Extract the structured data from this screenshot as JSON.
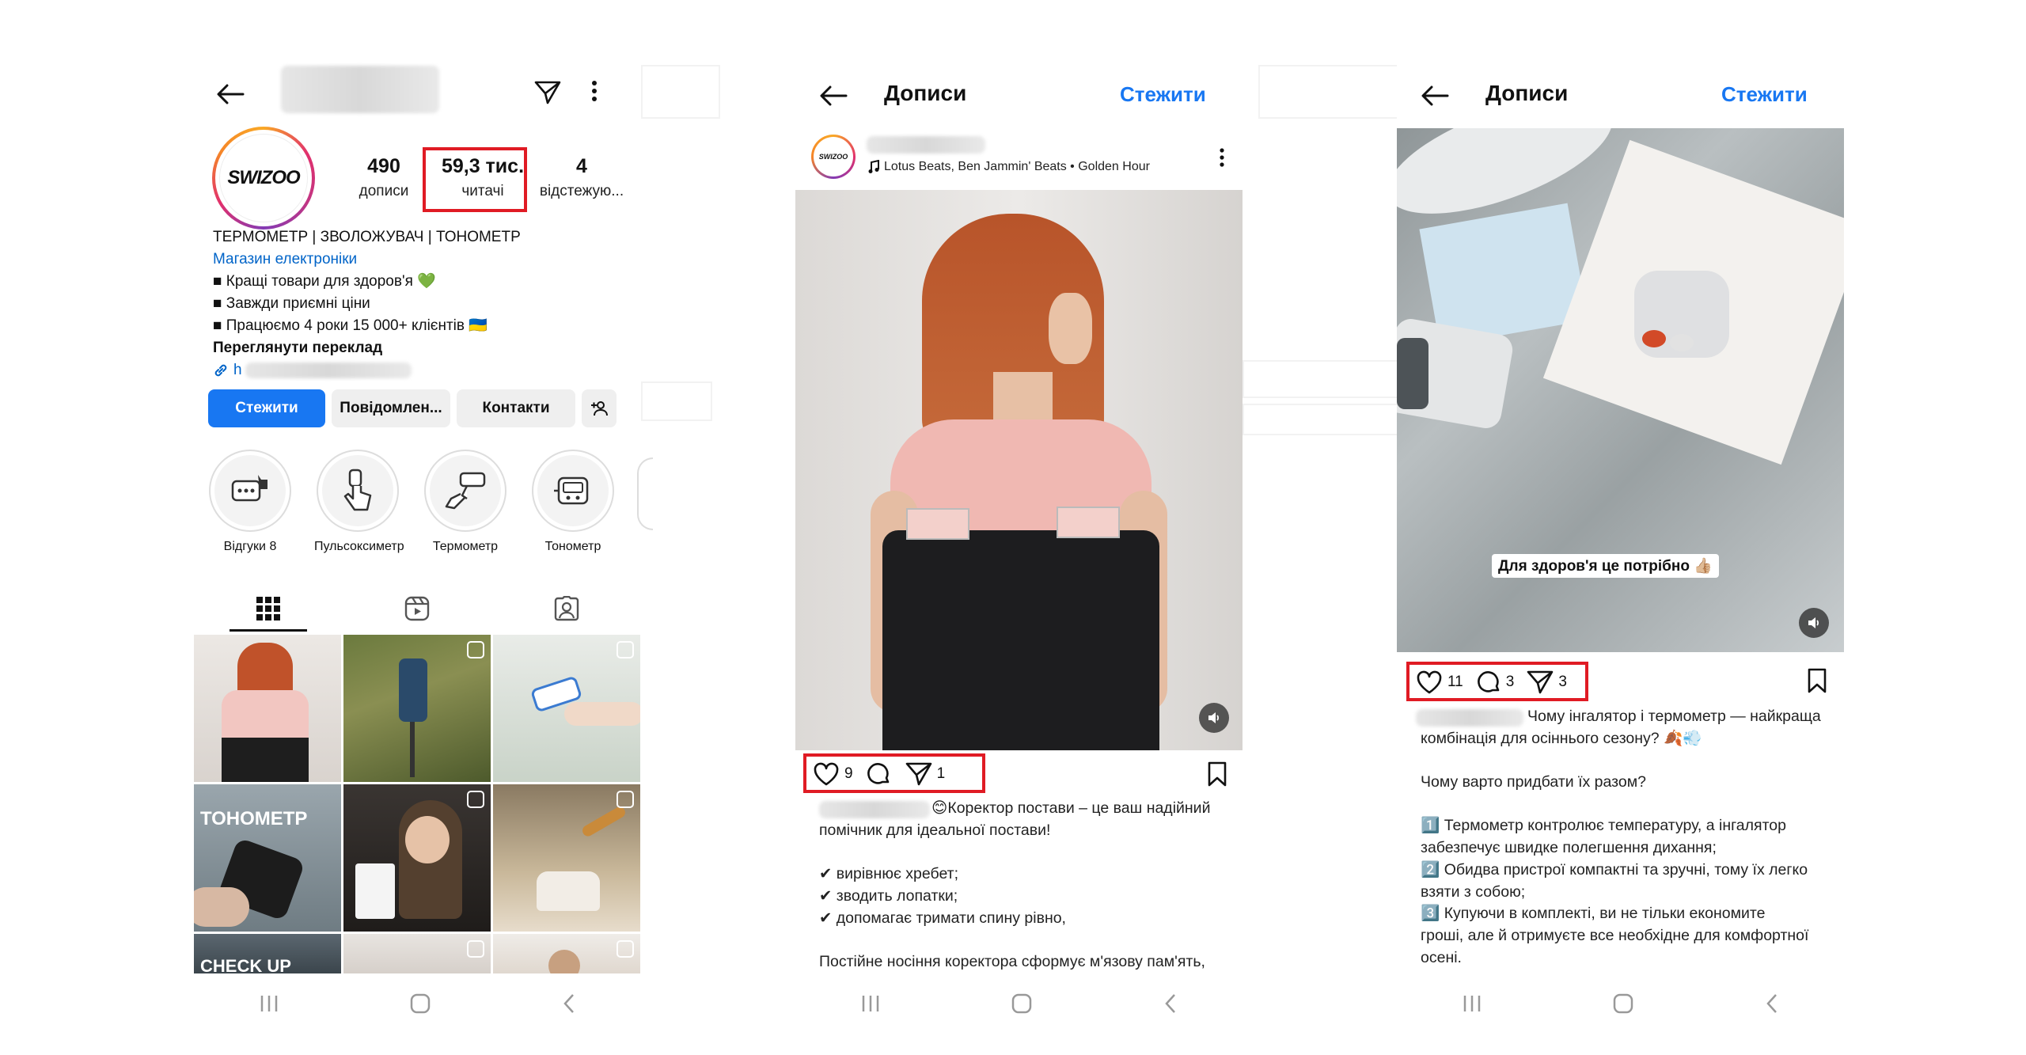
{
  "profile": {
    "stats": [
      {
        "value": "490",
        "label": "дописи"
      },
      {
        "value": "59,3 тис.",
        "label": "читачі"
      },
      {
        "value": "4",
        "label": "відстежую..."
      }
    ],
    "avatar_text": "SWIZOO",
    "bio_title": "ТЕРМОМЕТР | ЗВОЛОЖУВАЧ | ТОНОМЕТР",
    "category": "Магазин електроніки",
    "bio_lines": [
      "■ Кращі товари для здоров'я 💚",
      "■ Завжди приємні ціни",
      "■ Працюємо 4 роки 15 000+ клієнтів 🇺🇦"
    ],
    "see_translation": "Переглянути переклад",
    "link_prefix": "h",
    "buttons": {
      "follow": "Стежити",
      "message": "Повідомлен...",
      "contacts": "Контакти"
    },
    "highlights": [
      {
        "label": "Відгуки 8",
        "icon": "reviews-icon"
      },
      {
        "label": "Пульсоксиметр",
        "icon": "finger-pulse-icon"
      },
      {
        "label": "Термометр",
        "icon": "thermometer-gun-icon"
      },
      {
        "label": "Тонометр",
        "icon": "tonometer-icon"
      }
    ],
    "grid_texts": {
      "tonometer": "ТОНОМЕТР",
      "checkup": "CHECK UP"
    }
  },
  "post1": {
    "title": "Дописи",
    "follow": "Стежити",
    "music": "Lotus Beats, Ben Jammin' Beats • Golden Hour",
    "likes": "9",
    "shares": "1",
    "caption_lines": [
      "😊Коректор постави – це ваш надійний",
      "помічник для ідеальної постави!",
      "",
      "✔ вирівнює хребет;",
      "✔ зводить лопатки;",
      "✔ допомагає тримати спину рівно,",
      "",
      "Постійне носіння коректора сформує м'язову пам'ять,"
    ]
  },
  "post2": {
    "title": "Дописи",
    "follow": "Стежити",
    "overlay": "Для здоров'я це потрібно 👍🏼",
    "likes": "11",
    "comments": "3",
    "shares": "3",
    "caption_lines": [
      "Чому інгалятор і термометр — найкраща",
      "комбінація для осіннього сезону? 🍂💨",
      "",
      "Чому варто придбати їх разом?",
      "",
      "1️⃣ Термометр контролює температуру, а інгалятор",
      "забезпечує швидке полегшення дихання;",
      "2️⃣ Обидва пристрої компактні та зручні, тому їх легко",
      "взяти з собою;",
      "3️⃣ Купуючи в комплекті, ви не тільки економите",
      "гроші, але й отримуєте все необхідне для комфортної",
      "осені."
    ]
  },
  "colors": {
    "accent": "#1877f2",
    "highlight_box": "#e01b24"
  }
}
